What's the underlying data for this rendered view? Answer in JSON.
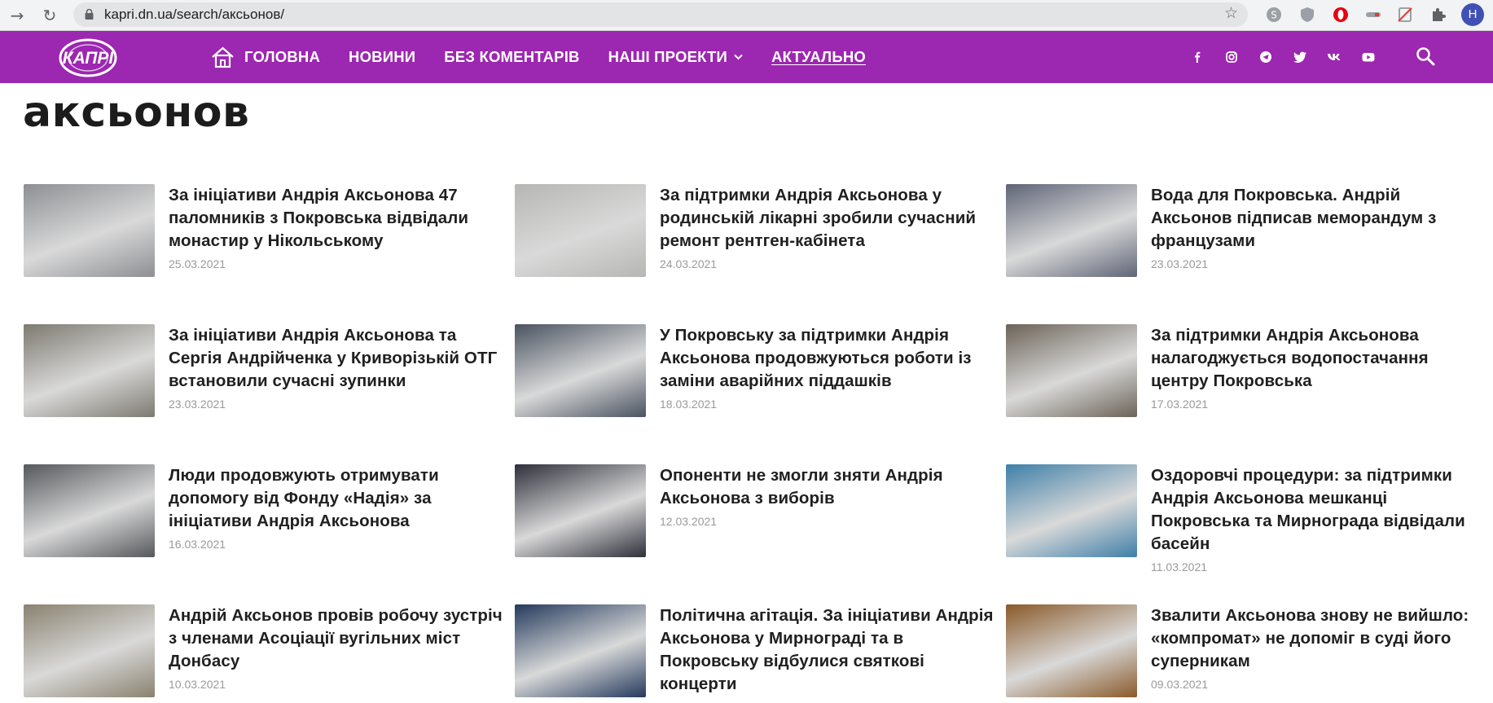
{
  "browser": {
    "url": "kapri.dn.ua/search/аксьонов/",
    "profile_initial": "H"
  },
  "site": {
    "logo_text": "КАПРІ",
    "brand_color": "#9c27b0",
    "menu": [
      {
        "label": "ГОЛОВНА"
      },
      {
        "label": "НОВИНИ"
      },
      {
        "label": "БЕЗ КОМЕНТАРІВ"
      },
      {
        "label": "НАШІ ПРОЕКТИ"
      },
      {
        "label": "АКТУАЛЬНО"
      }
    ],
    "social_icons": [
      "facebook-icon",
      "instagram-icon",
      "telegram-icon",
      "twitter-icon",
      "vk-icon",
      "youtube-icon"
    ]
  },
  "search": {
    "query": "аксьонов"
  },
  "results": [
    {
      "title": "За ініціативи Андрія Аксьонова 47 паломників з Покровська відвідали монастир у Нікольському",
      "date": "25.03.2021",
      "thumb": "#8d8f93"
    },
    {
      "title": "За підтримки Андрія Аксьонова у родинській лікарні зробили сучасний ремонт рентген-кабінета",
      "date": "24.03.2021",
      "thumb": "#b6b7b4"
    },
    {
      "title": "Вода для Покровська. Андрій Аксьонов підписав меморандум з французами",
      "date": "23.03.2021",
      "thumb": "#5f6577"
    },
    {
      "title": "За ініціативи Андрія Аксьонова та Сергія Андрійченка у Криворізькій ОТГ встановили сучасні зупинки",
      "date": "23.03.2021",
      "thumb": "#7d7a70"
    },
    {
      "title": "У Покровську за підтримки Андрія Аксьонова продовжуються роботи із заміни аварійних піддашків",
      "date": "18.03.2021",
      "thumb": "#4a5360"
    },
    {
      "title": "За підтримки Андрія Аксьонова налагоджується водопостачання центру Покровська",
      "date": "17.03.2021",
      "thumb": "#6b6358"
    },
    {
      "title": "Люди продовжують отримувати допомогу від Фонду «Надія» за ініціативи Андрія Аксьонова",
      "date": "16.03.2021",
      "thumb": "#55585c"
    },
    {
      "title": "Опоненти не змогли зняти Андрія Аксьонова з виборів",
      "date": "12.03.2021",
      "thumb": "#2e2f3a"
    },
    {
      "title": "Оздоровчі процедури: за підтримки Андрія Аксьонова мешканці Покровська та Мирнограда відвідали басейн",
      "date": "11.03.2021",
      "thumb": "#3f7fa8"
    },
    {
      "title": "Андрій Аксьонов провів робочу зустріч з членами Асоціації вугільних міст Донбасу",
      "date": "10.03.2021",
      "thumb": "#8a8270"
    },
    {
      "title": "Політична агітація. За ініціативи Андрія Аксьонова у Мирнограді та в Покровську відбулися святкові концерти",
      "date": "",
      "thumb": "#243a5c"
    },
    {
      "title": "Звалити Аксьонова знову не вийшло: «компромат» не допоміг в суді його суперникам",
      "date": "09.03.2021",
      "thumb": "#8a5a2a"
    }
  ]
}
